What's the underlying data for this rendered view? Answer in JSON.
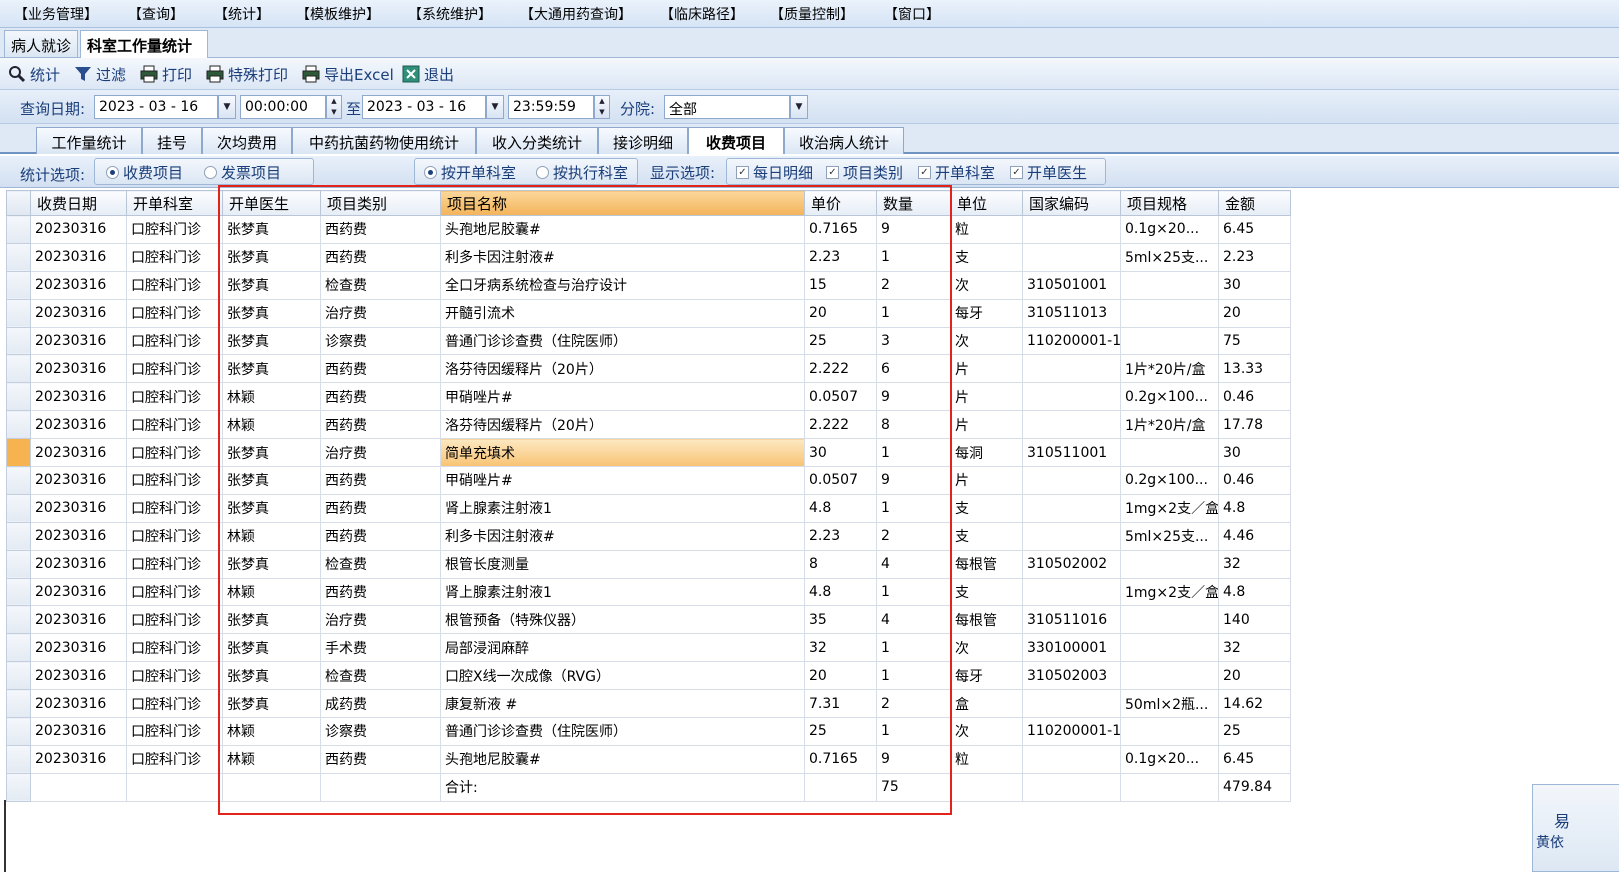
{
  "menu": [
    "【业务管理】",
    "【查询】",
    "【统计】",
    "【模板维护】",
    "【系统维护】",
    "【大通用药查询】",
    "【临床路径】",
    "【质量控制】",
    "【窗口】"
  ],
  "doc_tabs": [
    "病人就诊",
    "科室工作量统计"
  ],
  "toolbar": {
    "stat": "统计",
    "filter": "过滤",
    "print": "打印",
    "special_print": "特殊打印",
    "export": "导出Excel",
    "exit": "退出"
  },
  "query": {
    "date_label": "查询日期:",
    "start_date": "2023 - 03 - 16",
    "start_time": "00:00:00",
    "to_label": "至",
    "end_date": "2023 - 03 - 16",
    "end_time": "23:59:59",
    "branch_label": "分院:",
    "branch_value": "全部"
  },
  "report_tabs": [
    "工作量统计",
    "挂号",
    "次均费用",
    "中药抗菌药物使用统计",
    "收入分类统计",
    "接诊明细",
    "收费项目",
    "收治病人统计"
  ],
  "active_report_tab": "收费项目",
  "options": {
    "stat_label": "统计选项:",
    "stat_choices": [
      "收费项目",
      "发票项目"
    ],
    "dept_choices": [
      "按开单科室",
      "按执行科室"
    ],
    "display_label": "显示选项:",
    "display_choices": [
      "每日明细",
      "项目类别",
      "开单科室",
      "开单医生"
    ]
  },
  "table": {
    "columns": [
      "收费日期",
      "开单科室",
      "开单医生",
      "项目类别",
      "项目名称",
      "单价",
      "数量",
      "单位",
      "国家编码",
      "项目规格",
      "金额"
    ],
    "sorted_column": "项目名称",
    "selected_row": 8,
    "rows": [
      [
        "20230316",
        "口腔科门诊",
        "张梦真",
        "西药费",
        "头孢地尼胶囊#",
        "0.7165",
        "9",
        "粒",
        "",
        "0.1g×20...",
        "6.45"
      ],
      [
        "20230316",
        "口腔科门诊",
        "张梦真",
        "西药费",
        "利多卡因注射液#",
        "2.23",
        "1",
        "支",
        "",
        "5ml×25支...",
        "2.23"
      ],
      [
        "20230316",
        "口腔科门诊",
        "张梦真",
        "检查费",
        "全口牙病系统检查与治疗设计",
        "15",
        "2",
        "次",
        "310501001",
        "",
        "30"
      ],
      [
        "20230316",
        "口腔科门诊",
        "张梦真",
        "治疗费",
        "开髓引流术",
        "20",
        "1",
        "每牙",
        "310511013",
        "",
        "20"
      ],
      [
        "20230316",
        "口腔科门诊",
        "张梦真",
        "诊察费",
        "普通门诊诊查费（住院医师）",
        "25",
        "3",
        "次",
        "110200001-1",
        "",
        "75"
      ],
      [
        "20230316",
        "口腔科门诊",
        "张梦真",
        "西药费",
        "洛芬待因缓释片（20片）",
        "2.222",
        "6",
        "片",
        "",
        "1片*20片/盒",
        "13.33"
      ],
      [
        "20230316",
        "口腔科门诊",
        "林颖",
        "西药费",
        "甲硝唑片#",
        "0.0507",
        "9",
        "片",
        "",
        "0.2g×100...",
        "0.46"
      ],
      [
        "20230316",
        "口腔科门诊",
        "林颖",
        "西药费",
        "洛芬待因缓释片（20片）",
        "2.222",
        "8",
        "片",
        "",
        "1片*20片/盒",
        "17.78"
      ],
      [
        "20230316",
        "口腔科门诊",
        "张梦真",
        "治疗费",
        "简单充填术",
        "30",
        "1",
        "每洞",
        "310511001",
        "",
        "30"
      ],
      [
        "20230316",
        "口腔科门诊",
        "张梦真",
        "西药费",
        "甲硝唑片#",
        "0.0507",
        "9",
        "片",
        "",
        "0.2g×100...",
        "0.46"
      ],
      [
        "20230316",
        "口腔科门诊",
        "张梦真",
        "西药费",
        "肾上腺素注射液1",
        "4.8",
        "1",
        "支",
        "",
        "1mg×2支／盒",
        "4.8"
      ],
      [
        "20230316",
        "口腔科门诊",
        "林颖",
        "西药费",
        "利多卡因注射液#",
        "2.23",
        "2",
        "支",
        "",
        "5ml×25支...",
        "4.46"
      ],
      [
        "20230316",
        "口腔科门诊",
        "张梦真",
        "检查费",
        "根管长度测量",
        "8",
        "4",
        "每根管",
        "310502002",
        "",
        "32"
      ],
      [
        "20230316",
        "口腔科门诊",
        "林颖",
        "西药费",
        "肾上腺素注射液1",
        "4.8",
        "1",
        "支",
        "",
        "1mg×2支／盒",
        "4.8"
      ],
      [
        "20230316",
        "口腔科门诊",
        "张梦真",
        "治疗费",
        "根管预备（特殊仪器）",
        "35",
        "4",
        "每根管",
        "310511016",
        "",
        "140"
      ],
      [
        "20230316",
        "口腔科门诊",
        "张梦真",
        "手术费",
        "局部浸润麻醉",
        "32",
        "1",
        "次",
        "330100001",
        "",
        "32"
      ],
      [
        "20230316",
        "口腔科门诊",
        "张梦真",
        "检查费",
        "口腔X线一次成像（RVG）",
        "20",
        "1",
        "每牙",
        "310502003",
        "",
        "20"
      ],
      [
        "20230316",
        "口腔科门诊",
        "张梦真",
        "成药费",
        "康复新液 #",
        "7.31",
        "2",
        "盒",
        "",
        "50ml×2瓶...",
        "14.62"
      ],
      [
        "20230316",
        "口腔科门诊",
        "林颖",
        "诊察费",
        "普通门诊诊查费（住院医师）",
        "25",
        "1",
        "次",
        "110200001-1",
        "",
        "25"
      ],
      [
        "20230316",
        "口腔科门诊",
        "林颖",
        "西药费",
        "头孢地尼胶囊#",
        "0.7165",
        "9",
        "粒",
        "",
        "0.1g×20...",
        "6.45"
      ]
    ],
    "footer": [
      "",
      "",
      "",
      "",
      "合计:",
      "",
      "75",
      "",
      "",
      "",
      "479.84"
    ]
  },
  "popup": {
    "char": "易",
    "text": "黄依"
  }
}
